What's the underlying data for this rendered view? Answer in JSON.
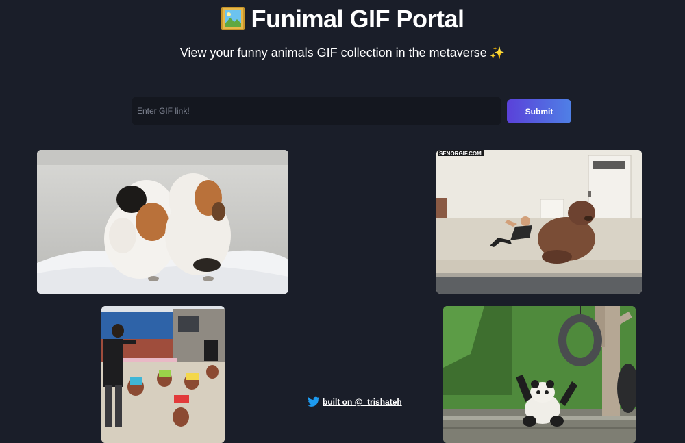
{
  "header": {
    "emoji": "🖼️",
    "title": "Funimal GIF Portal",
    "subtitle": "View your funny animals GIF collection in the metaverse",
    "sparkle": "✨"
  },
  "form": {
    "input_placeholder": "Enter GIF link!",
    "input_value": "",
    "submit_label": "Submit"
  },
  "gifs": [
    {
      "icon": "guinea-pigs-image"
    },
    {
      "icon": "walrus-workout-image",
      "watermark": "SENORGIF.COM"
    },
    {
      "icon": "dancing-dogs-image"
    },
    {
      "icon": "panda-tire-image"
    }
  ],
  "footer": {
    "icon": "twitter-icon",
    "link_text": "built on @_trishateh"
  },
  "colors": {
    "background": "#1a1e29",
    "input_background": "#14171f",
    "button_gradient_start": "#5a41d9",
    "button_gradient_end": "#4f80e6",
    "twitter_blue": "#1d9bf0"
  }
}
